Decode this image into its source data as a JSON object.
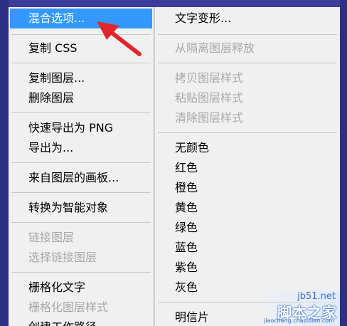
{
  "left_column": {
    "items": [
      {
        "label": "混合选项...",
        "state": "selected"
      },
      {
        "label": "复制 CSS",
        "state": "enabled"
      },
      {
        "label": "复制图层...",
        "state": "enabled"
      },
      {
        "label": "删除图层",
        "state": "enabled"
      },
      {
        "label": "快速导出为 PNG",
        "state": "enabled"
      },
      {
        "label": "导出为...",
        "state": "enabled"
      },
      {
        "label": "来自图层的画板...",
        "state": "enabled"
      },
      {
        "label": "转换为智能对象",
        "state": "enabled"
      },
      {
        "label": "链接图层",
        "state": "disabled"
      },
      {
        "label": "选择链接图层",
        "state": "disabled"
      },
      {
        "label": "栅格化文字",
        "state": "enabled"
      },
      {
        "label": "栅格化图层样式",
        "state": "disabled"
      },
      {
        "label": "创建工作路径",
        "state": "enabled"
      }
    ]
  },
  "right_column": {
    "items": [
      {
        "label": "文字变形...",
        "state": "enabled"
      },
      {
        "label": "从隔离图层释放",
        "state": "disabled"
      },
      {
        "label": "拷贝图层样式",
        "state": "disabled"
      },
      {
        "label": "粘贴图层样式",
        "state": "disabled"
      },
      {
        "label": "清除图层样式",
        "state": "disabled"
      },
      {
        "label": "无颜色",
        "state": "enabled"
      },
      {
        "label": "红色",
        "state": "enabled"
      },
      {
        "label": "橙色",
        "state": "enabled"
      },
      {
        "label": "黄色",
        "state": "enabled"
      },
      {
        "label": "绿色",
        "state": "enabled"
      },
      {
        "label": "蓝色",
        "state": "enabled"
      },
      {
        "label": "紫色",
        "state": "enabled"
      },
      {
        "label": "灰色",
        "state": "enabled"
      },
      {
        "label": "明信片",
        "state": "enabled"
      }
    ]
  },
  "watermark": {
    "site": "jb51.net",
    "text": "脚本之家",
    "url": "jiaocheng.chazidian.com"
  },
  "colors": {
    "selection": "#3399ff",
    "arrow": "#e0262c",
    "menu_bg": "#f0f0f0",
    "disabled_text": "#a8a8a8"
  }
}
